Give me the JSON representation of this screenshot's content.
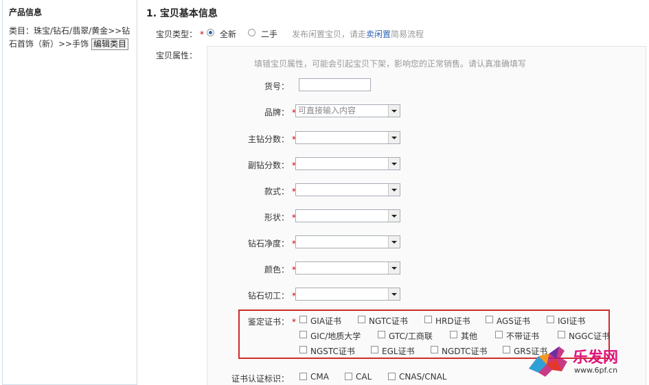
{
  "sidebar": {
    "title": "产品信息",
    "category_text": "类目：珠宝/钻石/翡翠/黄金>>钻石首饰（新）>>手饰",
    "edit_button": "编辑类目"
  },
  "section": {
    "title": "1. 宝贝基本信息"
  },
  "item_type": {
    "label": "宝贝类型：",
    "options": [
      "全新",
      "二手"
    ],
    "selected": "全新",
    "hint_prefix": "发布闲置宝贝，请走",
    "hint_link": "卖闲置",
    "hint_suffix": "简易流程"
  },
  "attributes": {
    "label": "宝贝属性：",
    "warning": "填错宝贝属性，可能会引起宝贝下架，影响您的正常销售。请认真准确填写",
    "fields": {
      "sku": {
        "label": "货号：",
        "value": ""
      },
      "brand": {
        "label": "品牌：",
        "placeholder": "可直接输入内容"
      },
      "main_carat": {
        "label": "主钻分数：",
        "value": ""
      },
      "side_carat": {
        "label": "副钻分数：",
        "value": ""
      },
      "style": {
        "label": "款式：",
        "value": ""
      },
      "shape": {
        "label": "形状：",
        "value": ""
      },
      "clarity": {
        "label": "钻石净度：",
        "value": ""
      },
      "color": {
        "label": "颜色：",
        "value": ""
      },
      "cut": {
        "label": "钻石切工：",
        "value": ""
      }
    },
    "certificate": {
      "label": "鉴定证书：",
      "options": [
        "GIA证书",
        "NGTC证书",
        "HRD证书",
        "AGS证书",
        "IGI证书",
        "GIC/地质大学",
        "GTC/工商联",
        "其他",
        "不带证书",
        "NGGC证书",
        "NGSTC证书",
        "EGL证书",
        "NGDTC证书",
        "GRS证书"
      ]
    },
    "cert_mark": {
      "label": "证书认证标识：",
      "options": [
        "CMA",
        "CAL",
        "CNAS/CNAL"
      ]
    }
  },
  "watermark": {
    "brand": "乐发网",
    "url": "www.6pf.cn"
  },
  "colors": {
    "required": "#cc0000",
    "link": "#2b62b8",
    "highlight_frame": "#d02a2a",
    "watermark": "#e0147a"
  }
}
